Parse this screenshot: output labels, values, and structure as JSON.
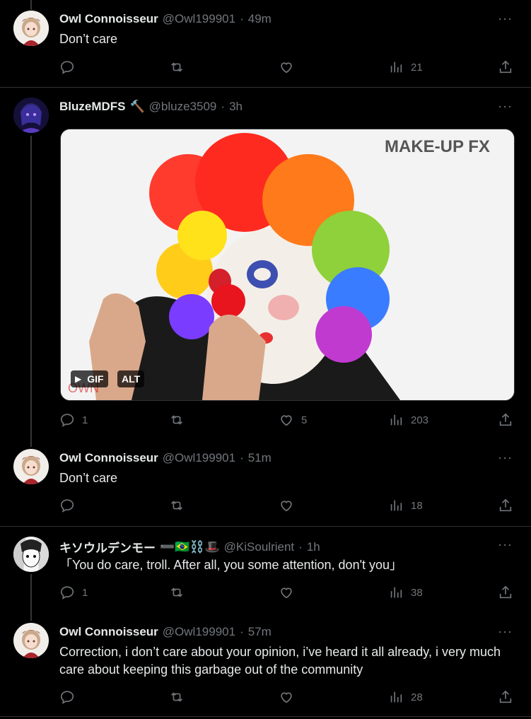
{
  "tweets": [
    {
      "name": "Owl Connoisseur",
      "handle": "@Owl199901",
      "dot": "·",
      "time": "49m",
      "text": "Don’t care",
      "replies": "",
      "reposts": "",
      "likes": "",
      "views": "21"
    },
    {
      "name": "BluzeMDFS",
      "name_emoji": "🔨",
      "handle": "@bluze3509",
      "dot": "·",
      "time": "3h",
      "media": {
        "watermark": "MAKE-UP FX",
        "corner_mark": "OWN",
        "gif_label": "GIF",
        "alt_label": "ALT",
        "play_glyph": "▶"
      },
      "replies": "1",
      "reposts": "",
      "likes": "5",
      "views": "203"
    },
    {
      "name": "Owl Connoisseur",
      "handle": "@Owl199901",
      "dot": "·",
      "time": "51m",
      "text": "Don’t care",
      "replies": "",
      "reposts": "",
      "likes": "",
      "views": "18"
    },
    {
      "name": "キソウルデンモー",
      "name_emoji": "➖🇧🇷⛓️🎩",
      "handle": "@KiSoulrient",
      "dot": "·",
      "time": "1h",
      "text": "「You do care, troll. After all, you some attention, don't you」",
      "replies": "1",
      "reposts": "",
      "likes": "",
      "views": "38"
    },
    {
      "name": "Owl Connoisseur",
      "handle": "@Owl199901",
      "dot": "·",
      "time": "57m",
      "text": "Correction, i don’t care about your opinion, i’ve heard it all already, i very much care about keeping this garbage out of the community",
      "replies": "",
      "reposts": "",
      "likes": "",
      "views": "28"
    }
  ],
  "more_glyph": "···",
  "colors": {
    "background": "#000000",
    "text": "#e7e9ea",
    "muted": "#71767b",
    "divider": "#2f3336"
  }
}
